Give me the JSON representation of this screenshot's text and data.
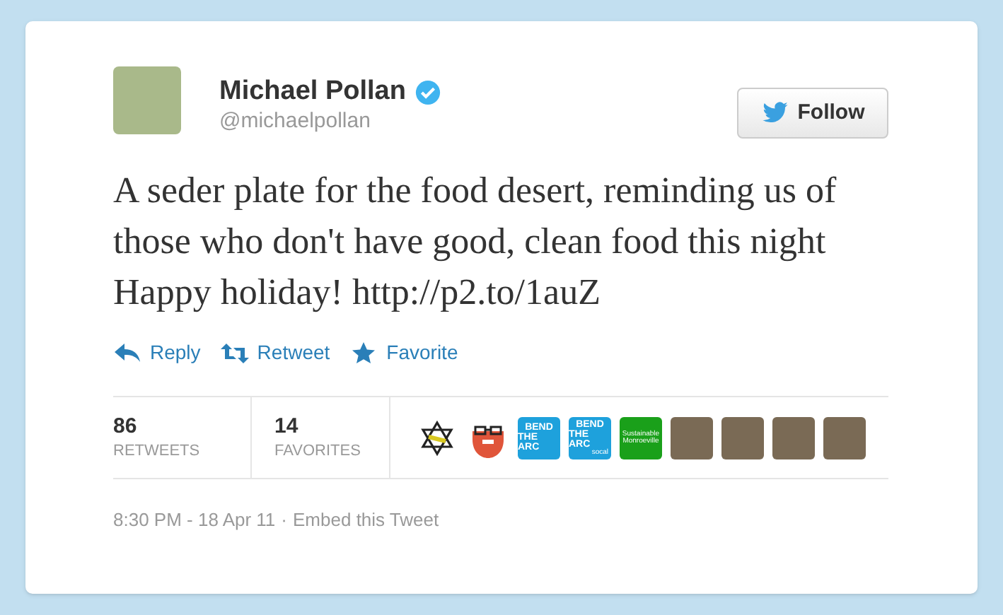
{
  "author": {
    "name": "Michael Pollan",
    "verified": true,
    "handle": "@michaelpollan"
  },
  "follow_button": {
    "label": "Follow"
  },
  "tweet_text": "A seder plate for the food desert, reminding us of those who don't have good, clean food this night Happy holiday! http://p2.to/1auZ",
  "actions": [
    {
      "kind": "reply",
      "label": "Reply"
    },
    {
      "kind": "retweet",
      "label": "Retweet"
    },
    {
      "kind": "favorite",
      "label": "Favorite"
    }
  ],
  "stats": [
    {
      "count": "86",
      "label": "RETWEETS"
    },
    {
      "count": "14",
      "label": "FAVORITES"
    }
  ],
  "avatars": [
    {
      "kind": "star-logo"
    },
    {
      "kind": "beard"
    },
    {
      "kind": "text-logo",
      "color": "#1ea1dc",
      "lines": [
        "BEND",
        "THE ARC"
      ]
    },
    {
      "kind": "text-logo",
      "color": "#1ea1dc",
      "lines": [
        "BEND",
        "THE ARC",
        "socal"
      ]
    },
    {
      "kind": "text-logo",
      "color": "#1aa01a",
      "lines": [
        "Sustainable",
        "Monroeville"
      ]
    },
    {
      "kind": "photo"
    },
    {
      "kind": "photo"
    },
    {
      "kind": "photo"
    },
    {
      "kind": "photo"
    }
  ],
  "footer": {
    "timestamp": "8:30 PM - 18 Apr 11",
    "separator": "·",
    "embed_link": "Embed this Tweet"
  }
}
